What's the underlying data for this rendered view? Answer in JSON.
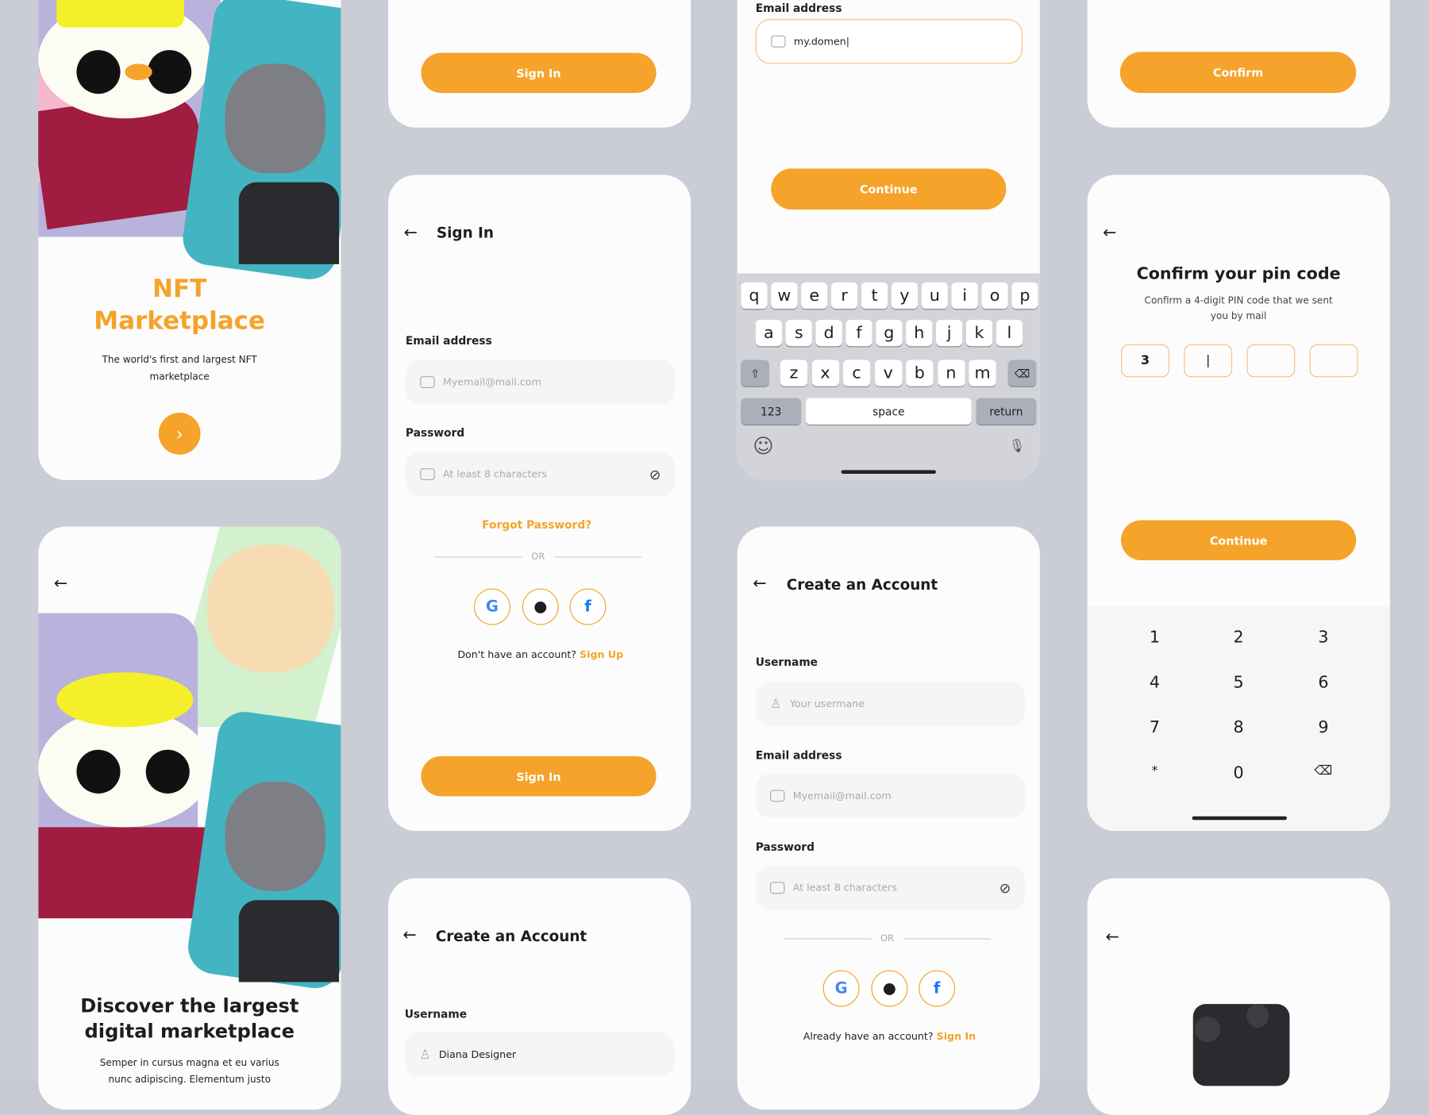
{
  "colors": {
    "accent": "#f5a32a",
    "background": "#cacdd6",
    "card": "#fcfcfc"
  },
  "onboarding1": {
    "title_line1": "NFT",
    "title_line2": "Marketplace",
    "subtitle": "The world's first and largest NFT marketplace",
    "next_icon": "chevron-right-icon"
  },
  "signin_top": {
    "button": "Sign In"
  },
  "email_entry": {
    "label": "Email address",
    "value": "my.domen|",
    "button": "Continue",
    "keyboard": {
      "row1": [
        "q",
        "w",
        "e",
        "r",
        "t",
        "y",
        "u",
        "i",
        "o",
        "p"
      ],
      "row2": [
        "a",
        "s",
        "d",
        "f",
        "g",
        "h",
        "j",
        "k",
        "l"
      ],
      "row3": [
        "z",
        "x",
        "c",
        "v",
        "b",
        "n",
        "m"
      ],
      "num": "123",
      "space": "space",
      "return": "return"
    }
  },
  "confirm_top": {
    "button": "Confirm"
  },
  "signin": {
    "title": "Sign In",
    "email_label": "Email address",
    "email_placeholder": "Myemail@mail.com",
    "password_label": "Password",
    "password_placeholder": "At least 8 characters",
    "forgot": "Forgot Password?",
    "or": "OR",
    "no_account": "Don't have an account?",
    "signup": "Sign Up",
    "button": "Sign In"
  },
  "pin": {
    "title": "Confirm your pin code",
    "subtitle": "Confirm a 4-digit PIN code that we sent you by mail",
    "digits": [
      "3",
      "|",
      "",
      ""
    ],
    "button": "Continue",
    "keypad": [
      "1",
      "2",
      "3",
      "4",
      "5",
      "6",
      "7",
      "8",
      "9",
      "*",
      "0",
      "⌫"
    ]
  },
  "onboarding2": {
    "title": "Discover the largest digital marketplace",
    "subtitle": "Semper in cursus magna et eu varius nunc adipiscing. Elementum justo"
  },
  "create": {
    "title": "Create an Account",
    "username_label": "Username",
    "username_placeholder": "Your usermane",
    "email_label": "Email address",
    "email_placeholder": "Myemail@mail.com",
    "password_label": "Password",
    "password_placeholder": "At least 8 characters",
    "or": "OR",
    "have_account": "Already have an account?",
    "signin": "Sign In"
  },
  "create2": {
    "title": "Create an Account",
    "username_label": "Username",
    "username_value": "Diana Designer"
  }
}
